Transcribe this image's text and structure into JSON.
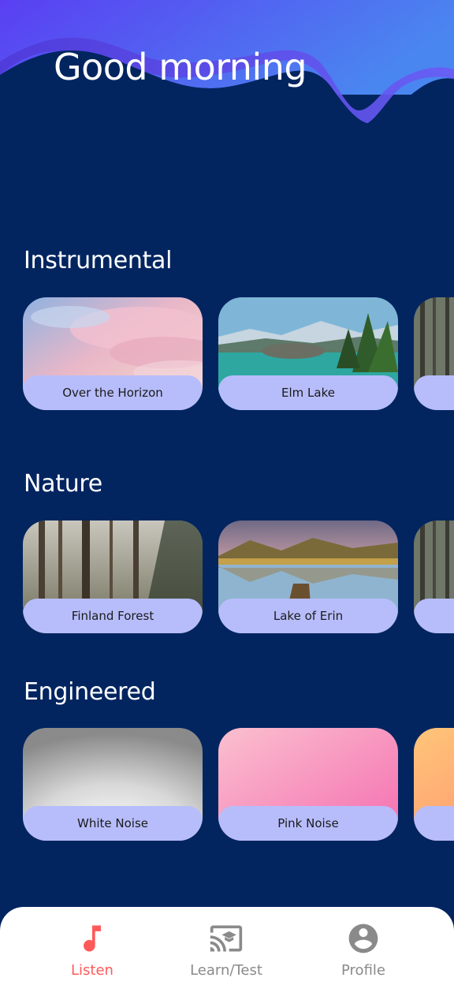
{
  "header": {
    "greeting": "Good morning"
  },
  "colors": {
    "background": "#022560",
    "card_label_bg": "#b7bdfb",
    "active_nav": "#ff5a5a",
    "inactive_nav": "#8a8a8a",
    "header_gradient_start": "#5a3ff2",
    "header_gradient_end": "#4a86f0"
  },
  "sections": [
    {
      "title": "Instrumental",
      "cards": [
        {
          "label": "Over the Horizon",
          "image": "pink-clouds-sky"
        },
        {
          "label": "Elm Lake",
          "image": "mountain-lake-pines"
        },
        {
          "label": "",
          "image": "forest"
        }
      ]
    },
    {
      "title": "Nature",
      "cards": [
        {
          "label": "Finland Forest",
          "image": "misty-forest"
        },
        {
          "label": "Lake of Erin",
          "image": "lake-dock-hills"
        },
        {
          "label": "",
          "image": "forest"
        }
      ]
    },
    {
      "title": "Engineered",
      "cards": [
        {
          "label": "White Noise",
          "image": "grey-radial-gradient"
        },
        {
          "label": "Pink Noise",
          "image": "pink-gradient"
        },
        {
          "label": "",
          "image": "orange-gradient"
        }
      ]
    }
  ],
  "nav": {
    "items": [
      {
        "label": "Listen",
        "icon": "music-note-icon",
        "active": true
      },
      {
        "label": "Learn/Test",
        "icon": "cast-education-icon",
        "active": false
      },
      {
        "label": "Profile",
        "icon": "account-circle-icon",
        "active": false
      }
    ]
  }
}
